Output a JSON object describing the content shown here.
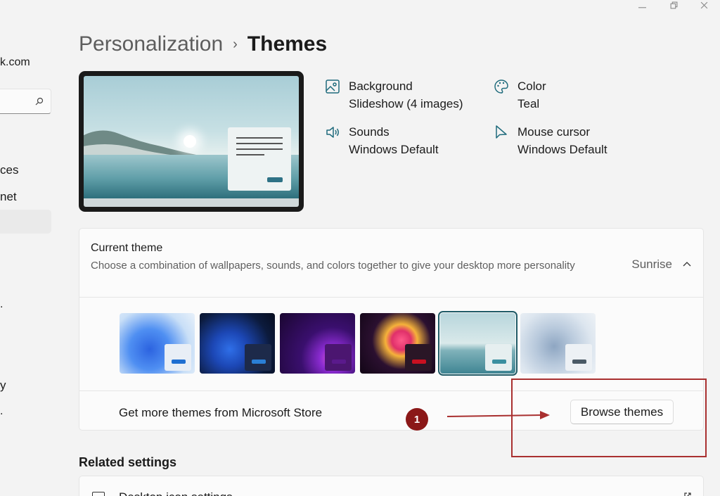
{
  "window": {
    "minimize_icon": "minimize-icon",
    "restore_icon": "restore-icon",
    "close_icon": "close-icon"
  },
  "sidebar": {
    "account_fragment": "k.com",
    "search_icon": "search-icon",
    "items": [
      {
        "label": "ces"
      },
      {
        "label": "net"
      },
      {
        "label": ""
      },
      {
        "label": "y"
      }
    ]
  },
  "breadcrumb": {
    "parent": "Personalization",
    "separator": "›",
    "current": "Themes"
  },
  "properties": {
    "background": {
      "title": "Background",
      "value": "Slideshow (4 images)",
      "icon": "image-icon"
    },
    "color": {
      "title": "Color",
      "value": "Teal",
      "icon": "palette-icon"
    },
    "sounds": {
      "title": "Sounds",
      "value": "Windows Default",
      "icon": "speaker-icon"
    },
    "mouse_cursor": {
      "title": "Mouse cursor",
      "value": "Windows Default",
      "icon": "cursor-icon"
    }
  },
  "current_theme": {
    "title": "Current theme",
    "description": "Choose a combination of wallpapers, sounds, and colors together to give your desktop more personality",
    "value": "Sunrise",
    "expanded": true,
    "themes": [
      {
        "name": "windows-light",
        "accent": "#1f6fd1",
        "selected": false
      },
      {
        "name": "windows-dark",
        "accent": "#2a7fd6",
        "selected": false
      },
      {
        "name": "glow",
        "accent": "#5a1a8c",
        "selected": false
      },
      {
        "name": "captured-motion",
        "accent": "#c81020",
        "selected": false
      },
      {
        "name": "sunrise",
        "accent": "#3a8fa0",
        "selected": true
      },
      {
        "name": "flow",
        "accent": "#4a5a66",
        "selected": false
      }
    ],
    "store_text": "Get more themes from Microsoft Store",
    "browse_label": "Browse themes"
  },
  "annotation": {
    "badge": "1",
    "color": "#8b1818"
  },
  "related": {
    "heading": "Related settings",
    "first_item": "Desktop icon settings"
  }
}
